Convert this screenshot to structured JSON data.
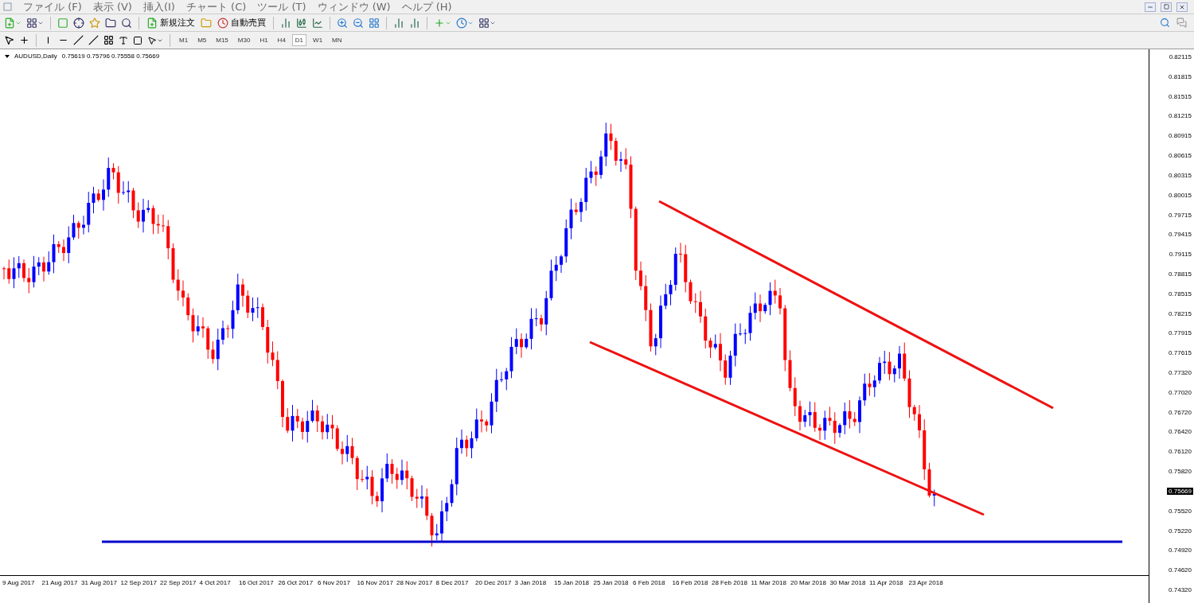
{
  "menu": [
    "ファイル (F)",
    "表示 (V)",
    "挿入(I)",
    "チャート (C)",
    "ツール (T)",
    "ウィンドウ (W)",
    "ヘルプ (H)"
  ],
  "toolbar_buttons": [
    "新規注文",
    "自動売買"
  ],
  "timeframes": [
    {
      "label": "M1",
      "selected": false
    },
    {
      "label": "M5",
      "selected": false
    },
    {
      "label": "M15",
      "selected": false
    },
    {
      "label": "M30",
      "selected": false
    },
    {
      "label": "H1",
      "selected": false
    },
    {
      "label": "H4",
      "selected": false
    },
    {
      "label": "D1",
      "selected": true
    },
    {
      "label": "W1",
      "selected": false
    },
    {
      "label": "MN",
      "selected": false
    }
  ],
  "chart": {
    "symbol": "AUDUSD,Daily",
    "ohlc": "0.75619 0.75796 0.75558 0.75669",
    "current_price": "0.75669",
    "price_labels": [
      "0.82115",
      "0.81815",
      "0.81515",
      "0.81215",
      "0.80915",
      "0.80615",
      "0.80315",
      "0.80015",
      "0.79715",
      "0.79415",
      "0.79115",
      "0.78815",
      "0.78515",
      "0.78215",
      "0.77915",
      "0.77615",
      "0.77320",
      "0.77020",
      "0.76720",
      "0.76420",
      "0.76120",
      "0.75820",
      "0.75520",
      "0.75220",
      "0.74920",
      "0.74620",
      "0.74320"
    ],
    "date_labels": [
      "9 Aug 2017",
      "21 Aug 2017",
      "31 Aug 2017",
      "12 Sep 2017",
      "22 Sep 2017",
      "4 Oct 2017",
      "16 Oct 2017",
      "26 Oct 2017",
      "6 Nov 2017",
      "16 Nov 2017",
      "28 Nov 2017",
      "8 Dec 2017",
      "20 Dec 2017",
      "3 Jan 2018",
      "15 Jan 2018",
      "25 Jan 2018",
      "6 Feb 2018",
      "16 Feb 2018",
      "28 Feb 2018",
      "11 Mar 2018",
      "20 Mar 2018",
      "30 Mar 2018",
      "11 Apr 2018",
      "23 Apr 2018"
    ]
  }
}
